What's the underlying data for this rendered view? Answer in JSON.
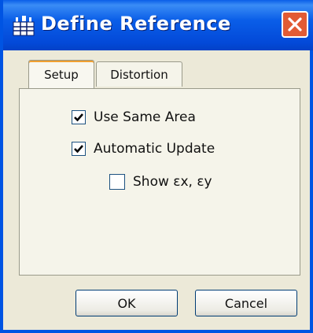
{
  "window": {
    "title": "Define Reference",
    "close_label": "×"
  },
  "tabs": [
    {
      "label": "Setup",
      "active": true
    },
    {
      "label": "Distortion",
      "active": false
    }
  ],
  "options": {
    "use_same_area": {
      "label": "Use Same Area",
      "checked": true
    },
    "automatic_update": {
      "label": "Automatic Update",
      "checked": true
    },
    "show_ex_ey": {
      "label": "Show εx, εy",
      "checked": false
    }
  },
  "buttons": {
    "ok": "OK",
    "cancel": "Cancel"
  },
  "colors": {
    "titlebar": "#0a5ee8",
    "close": "#e25b35",
    "face": "#ece9d8"
  },
  "icons": {
    "app": "grid-table-icon",
    "close": "close-icon",
    "check": "checkmark-icon"
  }
}
